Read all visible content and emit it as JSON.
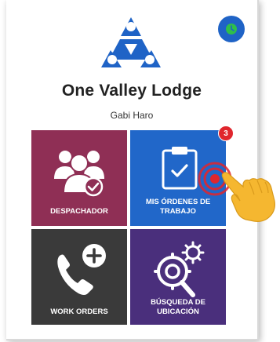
{
  "header": {
    "org_name": "One Valley Lodge",
    "user_name": "Gabi Haro"
  },
  "tiles": [
    {
      "label": "DESPACHADOR",
      "icon": "users-check-icon",
      "color": "#8f2f55"
    },
    {
      "label": "MIS ÓRDENES DE TRABAJO",
      "icon": "clipboard-check-icon",
      "color": "#2167c9",
      "badge": "3"
    },
    {
      "label": "WORK ORDERS",
      "icon": "phone-plus-icon",
      "color": "#3a3a3a"
    },
    {
      "label": "BÚSQUEDA DE UBICACIÓN",
      "icon": "location-gear-search-icon",
      "color": "#4a2f7c"
    }
  ],
  "colors": {
    "logo": "#1f63c6",
    "status": "#1f63c6",
    "badge": "#e0262d"
  }
}
